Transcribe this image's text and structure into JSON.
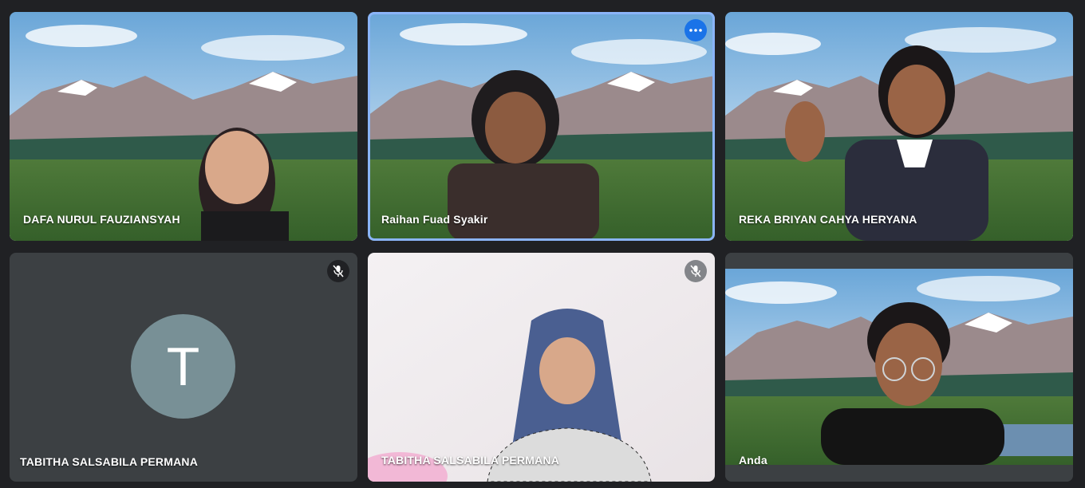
{
  "participants": [
    {
      "name": "DAFA NURUL FAUZIANSYAH"
    },
    {
      "name": "Raihan Fuad Syakir"
    },
    {
      "name": "REKA BRIYAN CAHYA HERYANA"
    },
    {
      "name": "TABITHA SALSABILA PERMANA",
      "avatar_initial": "T"
    },
    {
      "name": "TABITHA SALSABILA PERMANA"
    },
    {
      "name": "Anda"
    }
  ],
  "colors": {
    "background": "#202124",
    "tile": "#3c4043",
    "focus_ring": "#8ab4f8",
    "more_button": "#1a73e8",
    "avatar": "#789096"
  },
  "icons": {
    "more": "more-options-icon",
    "mic_off": "mic-off-icon"
  }
}
